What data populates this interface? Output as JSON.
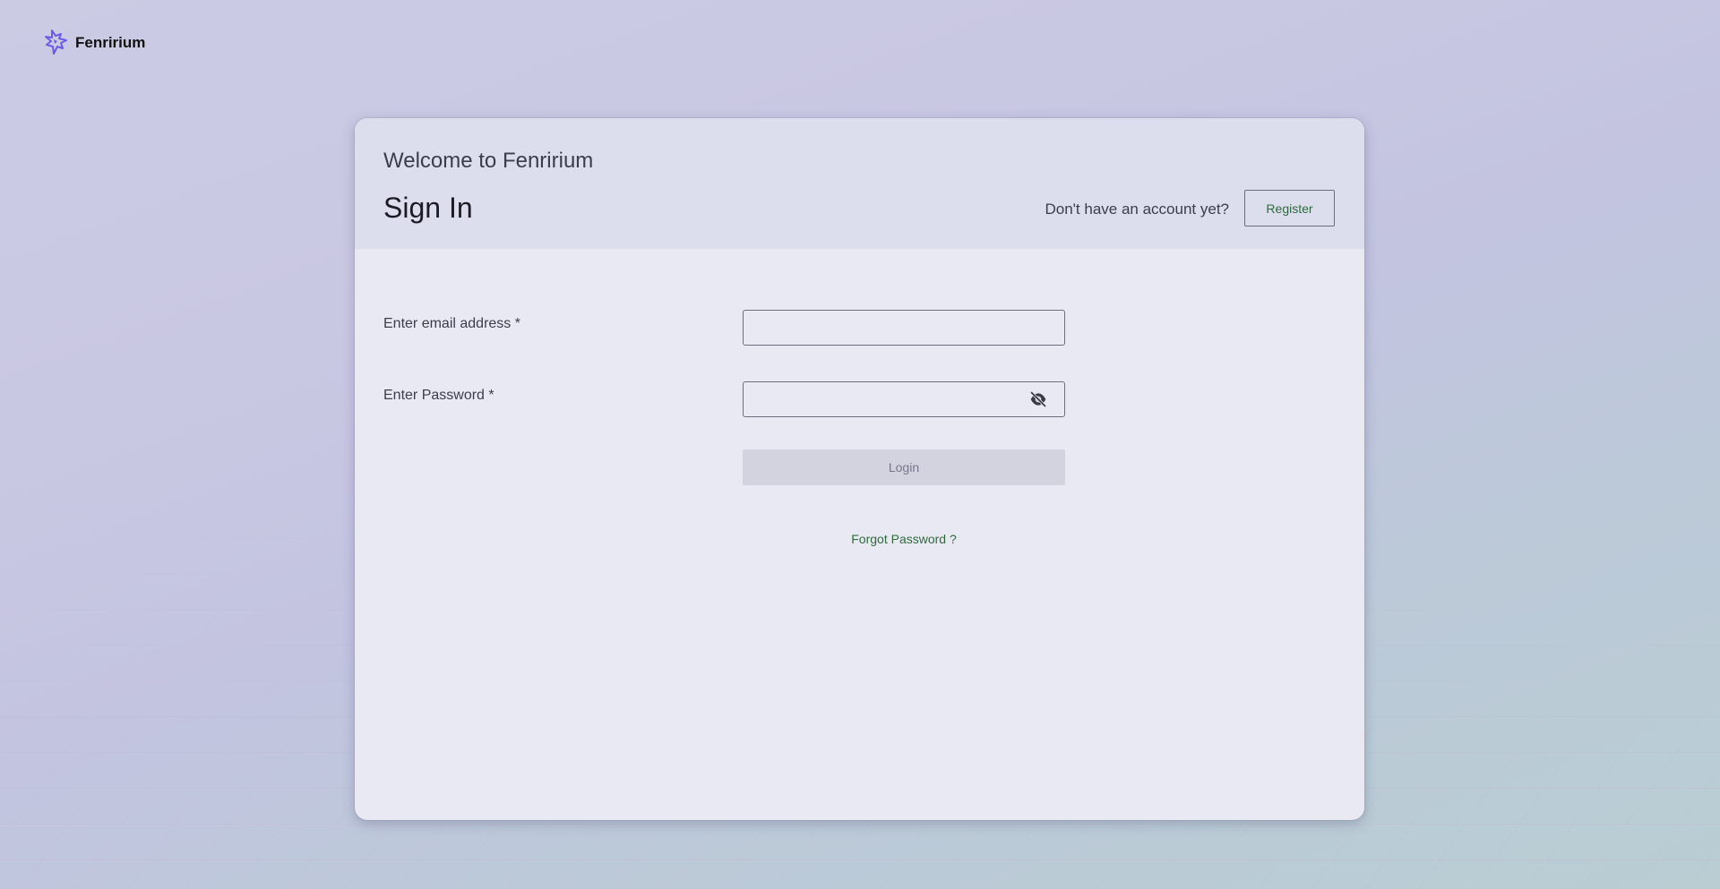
{
  "brand": {
    "name": "Fenririum",
    "logo_icon": "wolf-logo-icon",
    "logo_color": "#6b5ce7"
  },
  "card": {
    "welcome_text": "Welcome to Fenririum",
    "title": "Sign In",
    "no_account_text": "Don't have an account yet?",
    "register_label": "Register"
  },
  "form": {
    "email_label": "Enter email address *",
    "email_value": "",
    "password_label": "Enter Password *",
    "password_value": "",
    "password_toggle_icon": "eye-off-icon",
    "login_label": "Login",
    "login_disabled": true,
    "forgot_label": "Forgot Password ?"
  },
  "colors": {
    "accent_green": "#2e6a3e",
    "card_header_bg": "#dcdeed",
    "card_body_bg": "#e9e9f3",
    "disabled_button_bg": "#d2d3df"
  }
}
